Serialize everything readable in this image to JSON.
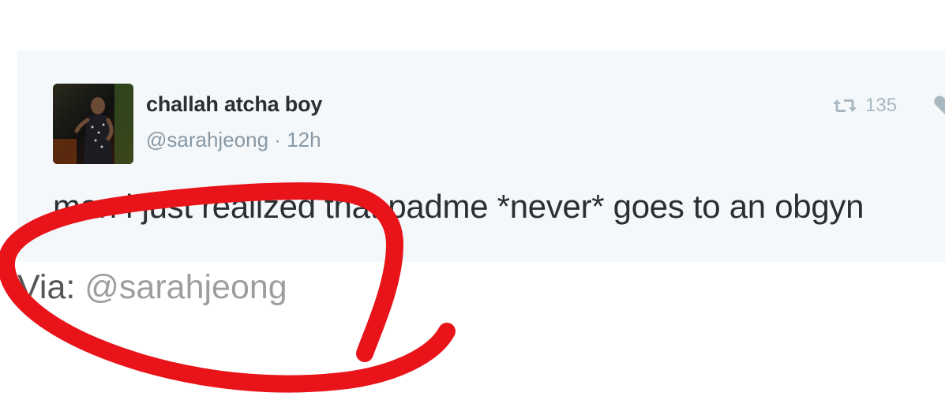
{
  "tweet": {
    "display_name": "challah atcha boy",
    "handle": "@sarahjeong",
    "separator": "·",
    "age": "12h",
    "retweet_count": "135",
    "text": "man i just realized that padme *never* goes to an obgyn"
  },
  "via": {
    "prefix": "Via:",
    "handle": "@sarahjeong"
  },
  "icons": {
    "retweet": "retweet-icon",
    "like": "heart-icon",
    "avatar": "profile-photo"
  },
  "colors": {
    "card_background": "#f5f8fa",
    "name": "#292f33",
    "muted": "#8899a6",
    "action_icons": "#aab8c2",
    "annotation_stroke": "#e8141a",
    "via_handle": "#9e9e9e"
  }
}
